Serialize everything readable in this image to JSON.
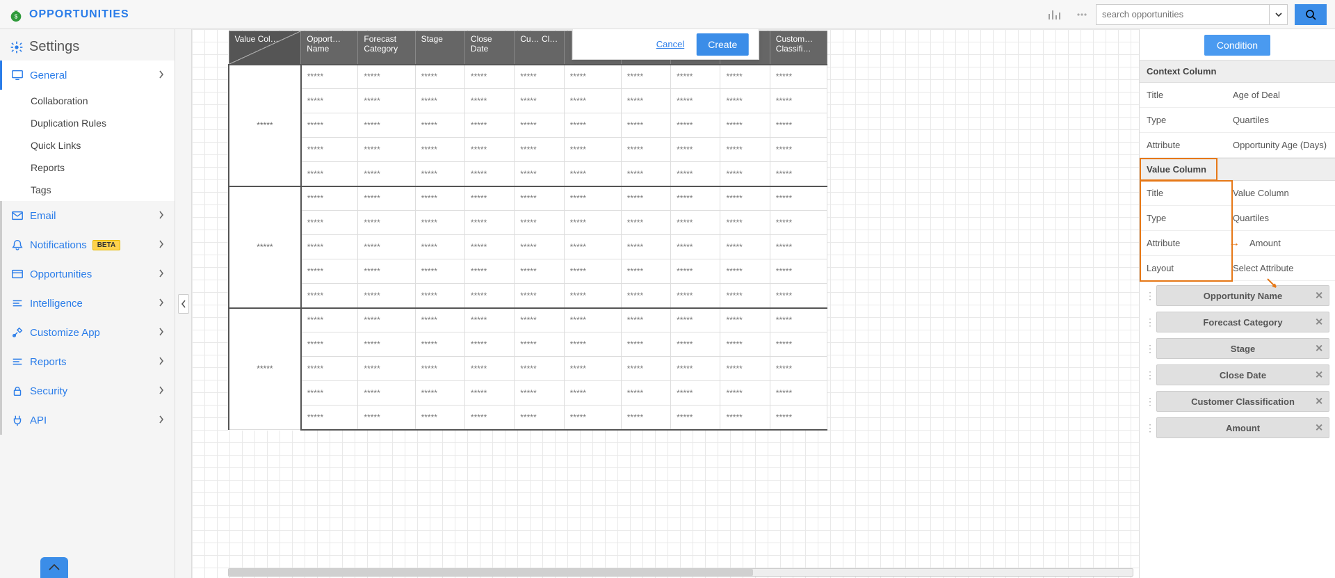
{
  "topbar": {
    "brand": "OPPORTUNITIES",
    "search_placeholder": "search opportunities"
  },
  "sidebar": {
    "title": "Settings",
    "main_items": [
      {
        "key": "general",
        "label": "General",
        "icon": "monitor",
        "active": true
      },
      {
        "key": "email",
        "label": "Email",
        "icon": "envelope",
        "active": false
      },
      {
        "key": "notifications",
        "label": "Notifications",
        "icon": "bell",
        "active": false,
        "badge": "BETA"
      },
      {
        "key": "opportunities",
        "label": "Opportunities",
        "icon": "card",
        "active": false
      },
      {
        "key": "intelligence",
        "label": "Intelligence",
        "icon": "lines",
        "active": false
      },
      {
        "key": "customize",
        "label": "Customize App",
        "icon": "tools",
        "active": false
      },
      {
        "key": "reports-m",
        "label": "Reports",
        "icon": "lines",
        "active": false
      },
      {
        "key": "security",
        "label": "Security",
        "icon": "lock",
        "active": false
      },
      {
        "key": "api",
        "label": "API",
        "icon": "plug",
        "active": false
      }
    ],
    "general_sub": [
      {
        "key": "collaboration",
        "label": "Collaboration"
      },
      {
        "key": "duplication",
        "label": "Duplication Rules"
      },
      {
        "key": "quick-links",
        "label": "Quick Links"
      },
      {
        "key": "reports",
        "label": "Reports"
      },
      {
        "key": "tags",
        "label": "Tags"
      }
    ]
  },
  "dialog": {
    "cancel": "Cancel",
    "create": "Create"
  },
  "table": {
    "pivot_header": "Value Col…",
    "headers": [
      "Opport… Name",
      "Forecast Category",
      "Stage",
      "Close Date",
      "Cu… Cl…",
      "",
      "",
      "",
      "",
      "Custom… Classifi…"
    ],
    "placeholder": "*****",
    "groups": 3,
    "rows_per_group": 5,
    "data_cols": 10
  },
  "config": {
    "condition_btn": "Condition",
    "context": {
      "header": "Context Column",
      "rows": [
        {
          "k": "Title",
          "v": "Age of Deal"
        },
        {
          "k": "Type",
          "v": "Quartiles"
        },
        {
          "k": "Attribute",
          "v": "Opportunity Age (Days)"
        }
      ]
    },
    "value": {
      "header": "Value Column",
      "rows": [
        {
          "k": "Title",
          "v": "Value Column"
        },
        {
          "k": "Type",
          "v": "Quartiles"
        },
        {
          "k": "Attribute",
          "v": "Amount",
          "arrow": true
        },
        {
          "k": "Layout",
          "v": "Select Attribute"
        }
      ]
    },
    "chips": [
      "Opportunity Name",
      "Forecast Category",
      "Stage",
      "Close Date",
      "Customer Classification",
      "Amount"
    ]
  }
}
